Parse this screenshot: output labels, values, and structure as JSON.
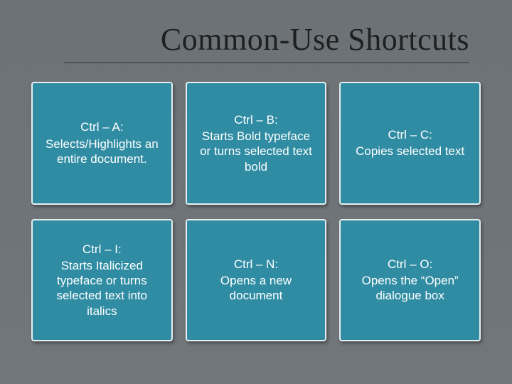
{
  "title": "Common-Use Shortcuts",
  "cards": [
    {
      "heading": "Ctrl – A:",
      "desc": "Selects/Highlights an entire document."
    },
    {
      "heading": "Ctrl – B:",
      "desc": "Starts Bold typeface or turns selected text bold"
    },
    {
      "heading": "Ctrl – C:",
      "desc": "Copies selected text"
    },
    {
      "heading": "Ctrl – I:",
      "desc": "Starts Italicized typeface or turns selected text into italics"
    },
    {
      "heading": "Ctrl – N:",
      "desc": "Opens a new document"
    },
    {
      "heading": "Ctrl – O:",
      "desc": "Opens the “Open” dialogue box"
    }
  ]
}
